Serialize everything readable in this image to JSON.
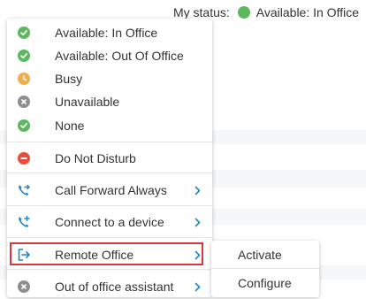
{
  "header": {
    "status_label": "My status:",
    "status_value": "Available: In Office"
  },
  "menu": {
    "items": [
      {
        "label": "Available: In Office",
        "icon": "check-circle-icon",
        "color": "#5cb85c"
      },
      {
        "label": "Available: Out Of Office",
        "icon": "check-circle-icon",
        "color": "#5cb85c"
      },
      {
        "label": "Busy",
        "icon": "clock-icon",
        "color": "#f0ad4e"
      },
      {
        "label": "Unavailable",
        "icon": "x-circle-icon",
        "color": "#8e8e8e"
      },
      {
        "label": "None",
        "icon": "check-circle-icon",
        "color": "#5cb85c"
      },
      {
        "label": "Do Not Disturb",
        "icon": "minus-circle-icon",
        "color": "#e74c3c"
      },
      {
        "label": "Call Forward Always",
        "icon": "call-forward-icon",
        "color": "#1e88c7"
      },
      {
        "label": "Connect to a device",
        "icon": "phone-plus-icon",
        "color": "#1e88c7"
      },
      {
        "label": "Remote Office",
        "icon": "exit-arrow-icon",
        "color": "#1e88c7"
      },
      {
        "label": "Out of office assistant",
        "icon": "x-circle-icon",
        "color": "#8e8e8e"
      }
    ]
  },
  "submenu": {
    "items": [
      {
        "label": "Activate"
      },
      {
        "label": "Configure"
      }
    ]
  },
  "colors": {
    "accent": "#1e88c7",
    "highlight_border": "#d9363e",
    "available": "#5cb85c",
    "busy": "#f0ad4e",
    "dnd": "#e74c3c",
    "neutral": "#8e8e8e"
  }
}
